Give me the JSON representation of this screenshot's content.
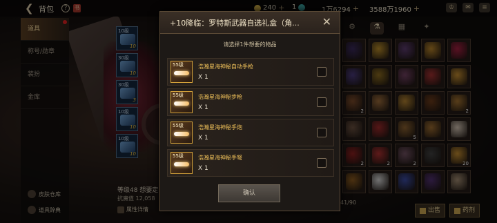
{
  "topbar": {
    "back_icon": "back-arrow-icon",
    "title": "背包",
    "help": "?",
    "currency": [
      {
        "icon": "gold-coin-icon",
        "value": "240",
        "color": "#d9b44a"
      },
      {
        "icon": "gem-icon",
        "value": "1",
        "color": "#3ba3a0"
      },
      {
        "icon": "silver-icon",
        "value": "1万6294",
        "color": "#c0c0c0"
      },
      {
        "icon": "gold-icon",
        "value": "3588万1960",
        "color": "#e2b33c"
      }
    ],
    "plus": "+"
  },
  "leftmenu": {
    "items": [
      "道具",
      "称号/勋章",
      "装扮",
      "金库"
    ],
    "footer": [
      "皮肤仓库",
      "道具辞典"
    ]
  },
  "slots": [
    {
      "level": "10级",
      "count": "10"
    },
    {
      "level": "30级",
      "count": "10"
    },
    {
      "level": "30级",
      "count": "3"
    },
    {
      "level": "10级",
      "count": "10"
    },
    {
      "level": "10级",
      "count": "10"
    }
  ],
  "character": {
    "level_text": "等级48 想要定",
    "resist_text": "抗魔值 12,058",
    "attr_button": "属性详情"
  },
  "inventory": {
    "count_text": "41/90",
    "sell_label": "出售",
    "potion_label": "药剂",
    "cells": [
      {
        "color": "#3a2a5a",
        "q": ""
      },
      {
        "color": "#b78a2a",
        "q": ""
      },
      {
        "color": "#5b3b6d",
        "q": ""
      },
      {
        "color": "#b3802a",
        "q": ""
      },
      {
        "color": "#a02040",
        "q": ""
      },
      {
        "color": "#4a3a7a",
        "q": ""
      },
      {
        "color": "#8b6a20",
        "q": ""
      },
      {
        "color": "#704060",
        "q": ""
      },
      {
        "color": "#a03030",
        "q": ""
      },
      {
        "color": "#c08a30",
        "q": ""
      },
      {
        "color": "#7a4a2a",
        "q": "2"
      },
      {
        "color": "#9a6a3a",
        "q": ""
      },
      {
        "color": "#b08030",
        "q": ""
      },
      {
        "color": "#6a3a1a",
        "q": ""
      },
      {
        "color": "#a07030",
        "q": "2"
      },
      {
        "color": "#6a5040",
        "q": ""
      },
      {
        "color": "#9a2a2a",
        "q": ""
      },
      {
        "color": "#8a6030",
        "q": "5"
      },
      {
        "color": "#9a6a30",
        "q": ""
      },
      {
        "color": "#d0c0b0",
        "q": ""
      },
      {
        "color": "#8a2020",
        "q": "2"
      },
      {
        "color": "#aa3030",
        "q": "2"
      },
      {
        "color": "#705060",
        "q": "2"
      },
      {
        "color": "#404040",
        "q": ""
      },
      {
        "color": "#c08a30",
        "q": "20"
      },
      {
        "color": "#8a5a20",
        "q": ""
      },
      {
        "color": "#d0d0d0",
        "q": ""
      },
      {
        "color": "#3a4aa0",
        "q": ""
      },
      {
        "color": "#503070",
        "q": ""
      },
      {
        "color": "#a08a70",
        "q": ""
      }
    ]
  },
  "modal": {
    "title": "+10降临：罗特斯武器自选礼盒（角...",
    "subtitle": "请选择1件想要的物品",
    "confirm": "确认",
    "items": [
      {
        "level": "55级",
        "name": "浩瀚星海神秘自动手枪",
        "qty": "X 1"
      },
      {
        "level": "55级",
        "name": "浩瀚星海神秘步枪",
        "qty": "X 1"
      },
      {
        "level": "55级",
        "name": "浩瀚星海神秘手炮",
        "qty": "X 1"
      },
      {
        "level": "55级",
        "name": "浩瀚星海神秘手弩",
        "qty": "X 1"
      }
    ]
  }
}
